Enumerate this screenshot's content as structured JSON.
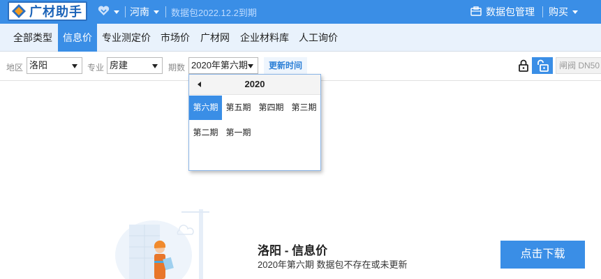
{
  "app": {
    "name": "广材助手",
    "province": "河南",
    "expire_text": "数据包2022.12.2到期",
    "package_manage": "数据包管理",
    "buy": "购买"
  },
  "tabs": [
    {
      "label": "全部类型",
      "active": false
    },
    {
      "label": "信息价",
      "active": true
    },
    {
      "label": "专业测定价",
      "active": false
    },
    {
      "label": "市场价",
      "active": false
    },
    {
      "label": "广材网",
      "active": false
    },
    {
      "label": "企业材料库",
      "active": false
    },
    {
      "label": "人工询价",
      "active": false
    }
  ],
  "filters": {
    "region_label": "地区",
    "region_value": "洛阳",
    "specialty_label": "专业",
    "specialty_value": "房建",
    "period_label": "期数",
    "period_value": "2020年第六期",
    "update_button": "更新时间",
    "search_value": "闸阀 DN50"
  },
  "period_picker": {
    "year": "2020",
    "periods": [
      "第六期",
      "第五期",
      "第四期",
      "第三期",
      "第二期",
      "第一期"
    ],
    "selected": "第六期"
  },
  "empty_state": {
    "title": "洛阳 - 信息价",
    "subtitle": "2020年第六期 数据包不存在或未更新",
    "download_button": "点击下载"
  },
  "colors": {
    "primary": "#3a8ee6",
    "tab_bar": "#e9f2fc"
  }
}
